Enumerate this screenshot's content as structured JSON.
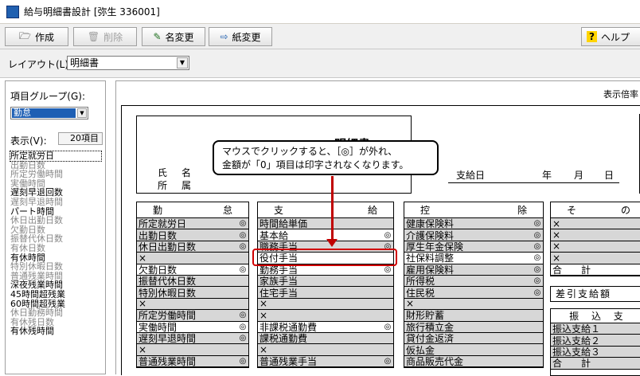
{
  "window": {
    "title": "給与明細書設計 [弥生 336001]",
    "icon": "app-icon"
  },
  "toolbar": {
    "create": {
      "label": "作成",
      "icon": "create-icon"
    },
    "delete": {
      "label": "削除",
      "icon": "trash-icon"
    },
    "rename": {
      "label": "名変更",
      "icon": "pencil-icon"
    },
    "paper": {
      "label": "紙変更",
      "icon": "paper-icon"
    },
    "help": {
      "label": "ヘルプ",
      "icon": "help-icon"
    }
  },
  "layout": {
    "label": "レイアウト(L):",
    "value": "明細書"
  },
  "left": {
    "group_label": "項目グループ(G):",
    "group_value": "勤怠",
    "display_label": "表示(V):",
    "count": "20項目",
    "items": [
      {
        "label": "所定就労日",
        "on": true
      },
      {
        "label": "出勤日数",
        "on": false
      },
      {
        "label": "所定労働時間",
        "on": false
      },
      {
        "label": "実働時間",
        "on": false
      },
      {
        "label": "遅刻早退回数",
        "on": true
      },
      {
        "label": "遅刻早退時間",
        "on": false
      },
      {
        "label": "パート時間",
        "on": true
      },
      {
        "label": "休日出勤日数",
        "on": false
      },
      {
        "label": "欠勤日数",
        "on": false
      },
      {
        "label": "振替代休日数",
        "on": false
      },
      {
        "label": "有休日数",
        "on": false
      },
      {
        "label": "有休時間",
        "on": true
      },
      {
        "label": "特別休暇日数",
        "on": false
      },
      {
        "label": "普通残業時間",
        "on": false
      },
      {
        "label": "深夜残業時間",
        "on": true
      },
      {
        "label": "45時間超残業",
        "on": true
      },
      {
        "label": "60時間超残業",
        "on": true
      },
      {
        "label": "休日勤務時間",
        "on": false
      },
      {
        "label": "有休残日数",
        "on": false
      },
      {
        "label": "有休残時間",
        "on": true
      }
    ]
  },
  "sheet": {
    "zoom_label": "表示倍率",
    "doc_title": "明細書",
    "name_labels": [
      "氏",
      "名",
      "所",
      "属"
    ],
    "paydate": {
      "label": "支給日",
      "year": "年",
      "month": "月",
      "day": "日"
    },
    "mark": "◎",
    "cross": "×",
    "columns": {
      "attendance": {
        "head": [
          "勤",
          "怠"
        ],
        "rows": [
          {
            "label": "所定就労日",
            "mark": true,
            "grey": true
          },
          {
            "label": "出勤日数",
            "mark": true,
            "grey": true
          },
          {
            "label": "休日出勤日数",
            "mark": true,
            "grey": true
          },
          {
            "label": "×",
            "mark": false,
            "grey": true
          },
          {
            "label": "欠勤日数",
            "mark": true,
            "grey": false
          },
          {
            "label": "振替代休日数",
            "mark": false,
            "grey": true
          },
          {
            "label": "特別休暇日数",
            "mark": false,
            "grey": true
          },
          {
            "label": "×",
            "mark": false,
            "grey": true
          },
          {
            "label": "所定労働時間",
            "mark": true,
            "grey": true
          },
          {
            "label": "実働時間",
            "mark": true,
            "grey": false
          },
          {
            "label": "遅刻早退時間",
            "mark": true,
            "grey": true
          },
          {
            "label": "×",
            "mark": false,
            "grey": true
          },
          {
            "label": "普通残業時間",
            "mark": true,
            "grey": true
          }
        ]
      },
      "payment": {
        "head": [
          "支",
          "給"
        ],
        "rows": [
          {
            "label": "時間給単価",
            "mark": false,
            "grey": true
          },
          {
            "label": "基本給",
            "mark": true,
            "grey": false
          },
          {
            "label": "職務手当",
            "mark": true,
            "grey": true
          },
          {
            "label": "役付手当",
            "mark": false,
            "grey": false
          },
          {
            "label": "勤務手当",
            "mark": true,
            "grey": false
          },
          {
            "label": "家族手当",
            "mark": false,
            "grey": true
          },
          {
            "label": "住宅手当",
            "mark": false,
            "grey": true
          },
          {
            "label": "×",
            "mark": false,
            "grey": true
          },
          {
            "label": "×",
            "mark": false,
            "grey": true
          },
          {
            "label": "非課税通勤費",
            "mark": true,
            "grey": false
          },
          {
            "label": "課税通勤費",
            "mark": false,
            "grey": true
          },
          {
            "label": "×",
            "mark": false,
            "grey": true
          },
          {
            "label": "普通残業手当",
            "mark": true,
            "grey": true
          }
        ]
      },
      "deduction": {
        "head": [
          "控",
          "除"
        ],
        "rows": [
          {
            "label": "健康保険料",
            "mark": true,
            "grey": true
          },
          {
            "label": "介護保険料",
            "mark": true,
            "grey": true
          },
          {
            "label": "厚生年金保険",
            "mark": true,
            "grey": true
          },
          {
            "label": "社保料調整",
            "mark": true,
            "grey": false
          },
          {
            "label": "雇用保険料",
            "mark": true,
            "grey": true
          },
          {
            "label": "所得税",
            "mark": true,
            "grey": true
          },
          {
            "label": "住民税",
            "mark": true,
            "grey": true
          },
          {
            "label": "×",
            "mark": false,
            "grey": true
          },
          {
            "label": "財形貯蓄",
            "mark": false,
            "grey": true
          },
          {
            "label": "旅行積立金",
            "mark": false,
            "grey": true
          },
          {
            "label": "貸付金返済",
            "mark": false,
            "grey": true
          },
          {
            "label": "仮払金",
            "mark": false,
            "grey": true
          },
          {
            "label": "商品販売代金",
            "mark": false,
            "grey": true
          }
        ]
      },
      "other": {
        "head": [
          "そ",
          "の"
        ],
        "rows": [
          {
            "label": "×",
            "mark": false,
            "grey": true
          },
          {
            "label": "×",
            "mark": false,
            "grey": true
          },
          {
            "label": "×",
            "mark": false,
            "grey": true
          },
          {
            "label": "×",
            "mark": false,
            "grey": true
          },
          {
            "label": "合　　計",
            "mark": false,
            "grey": false
          }
        ],
        "net_pay": "差引支給額",
        "transfer_head": "振 込 支",
        "transfer_rows": [
          "振込支給１",
          "振込支給２",
          "振込支給３",
          "合　　計"
        ]
      }
    }
  },
  "callout": {
    "line1": "マウスでクリックすると、［◎］が外れ、",
    "line2": "金額が「0」項目は印字されなくなります。"
  }
}
